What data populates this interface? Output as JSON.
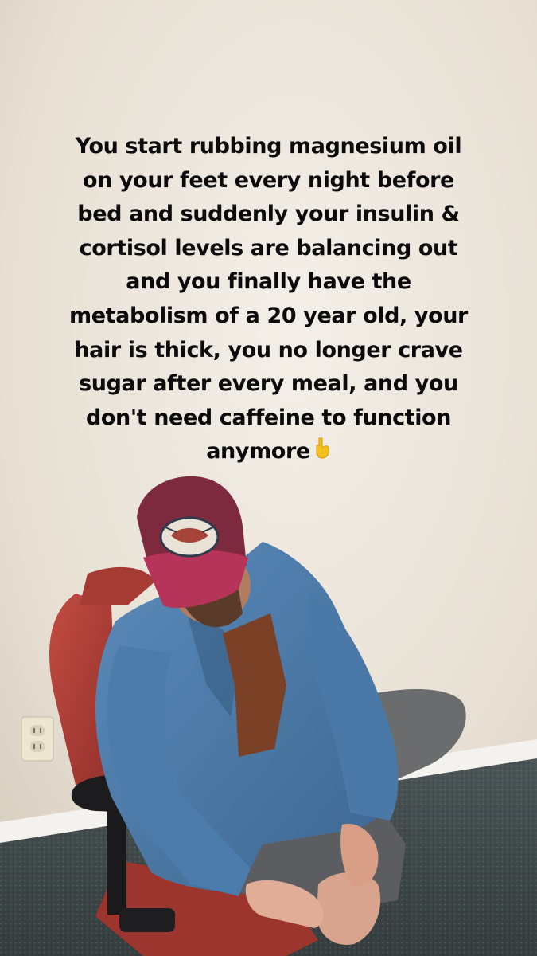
{
  "caption": {
    "lines": [
      "You start rubbing magnesium oil",
      "on your feet every night before",
      "bed and suddenly your insulin &",
      "cortisol levels are balancing out",
      "and you finally have the",
      "metabolism of a 20 year old, your",
      "hair is thick, you no longer crave",
      "sugar after every meal, and you",
      "don't need caffeine to function",
      "anymore"
    ],
    "emoji": "pointing-down-hand-icon"
  },
  "colors": {
    "wall": "#e8e1d6",
    "carpet": "#3f4a4b",
    "jacket": "#4f7fae",
    "cap": "#b0345a",
    "chair": "#b8453c"
  }
}
